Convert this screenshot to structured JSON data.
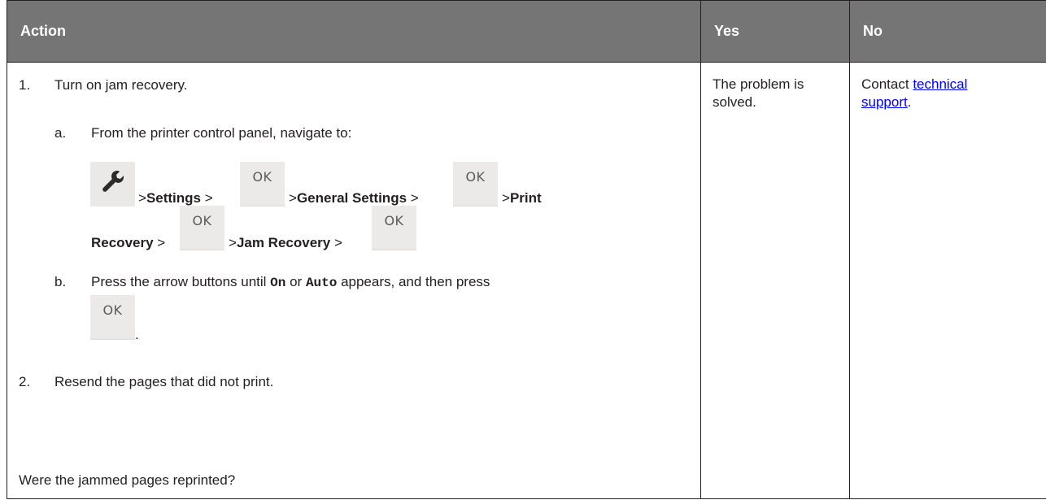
{
  "table": {
    "headers": {
      "action": "Action",
      "yes": "Yes",
      "no": "No"
    },
    "step1": {
      "num": "1.",
      "text": "Turn on jam recovery."
    },
    "stepA": {
      "letter": "a.",
      "text": "From the printer control panel, navigate to:"
    },
    "nav": {
      "gt": ">",
      "settings": "Settings",
      "general_settings": "General Settings",
      "print": "Print",
      "recovery": "Recovery",
      "jam_recovery": "Jam Recovery",
      "ok_label": "OK",
      "wrench_icon": "wrench-icon"
    },
    "stepB": {
      "letter": "b.",
      "text_before": "Press the arrow buttons until ",
      "on": "On",
      "or": " or ",
      "auto": "Auto",
      "text_after": " appears, and then press",
      "period": "."
    },
    "step2": {
      "num": "2.",
      "text": "Resend the pages that did not print."
    },
    "question": "Were the jammed pages reprinted?",
    "yes_text": "The problem is solved.",
    "no_text_before": "Contact ",
    "no_link": "technical support",
    "no_text_after": "."
  },
  "colors": {
    "header_bg": "#757575",
    "header_text": "#ffffff",
    "link": "#0000ff",
    "button_bg": "#ebe9e7"
  }
}
